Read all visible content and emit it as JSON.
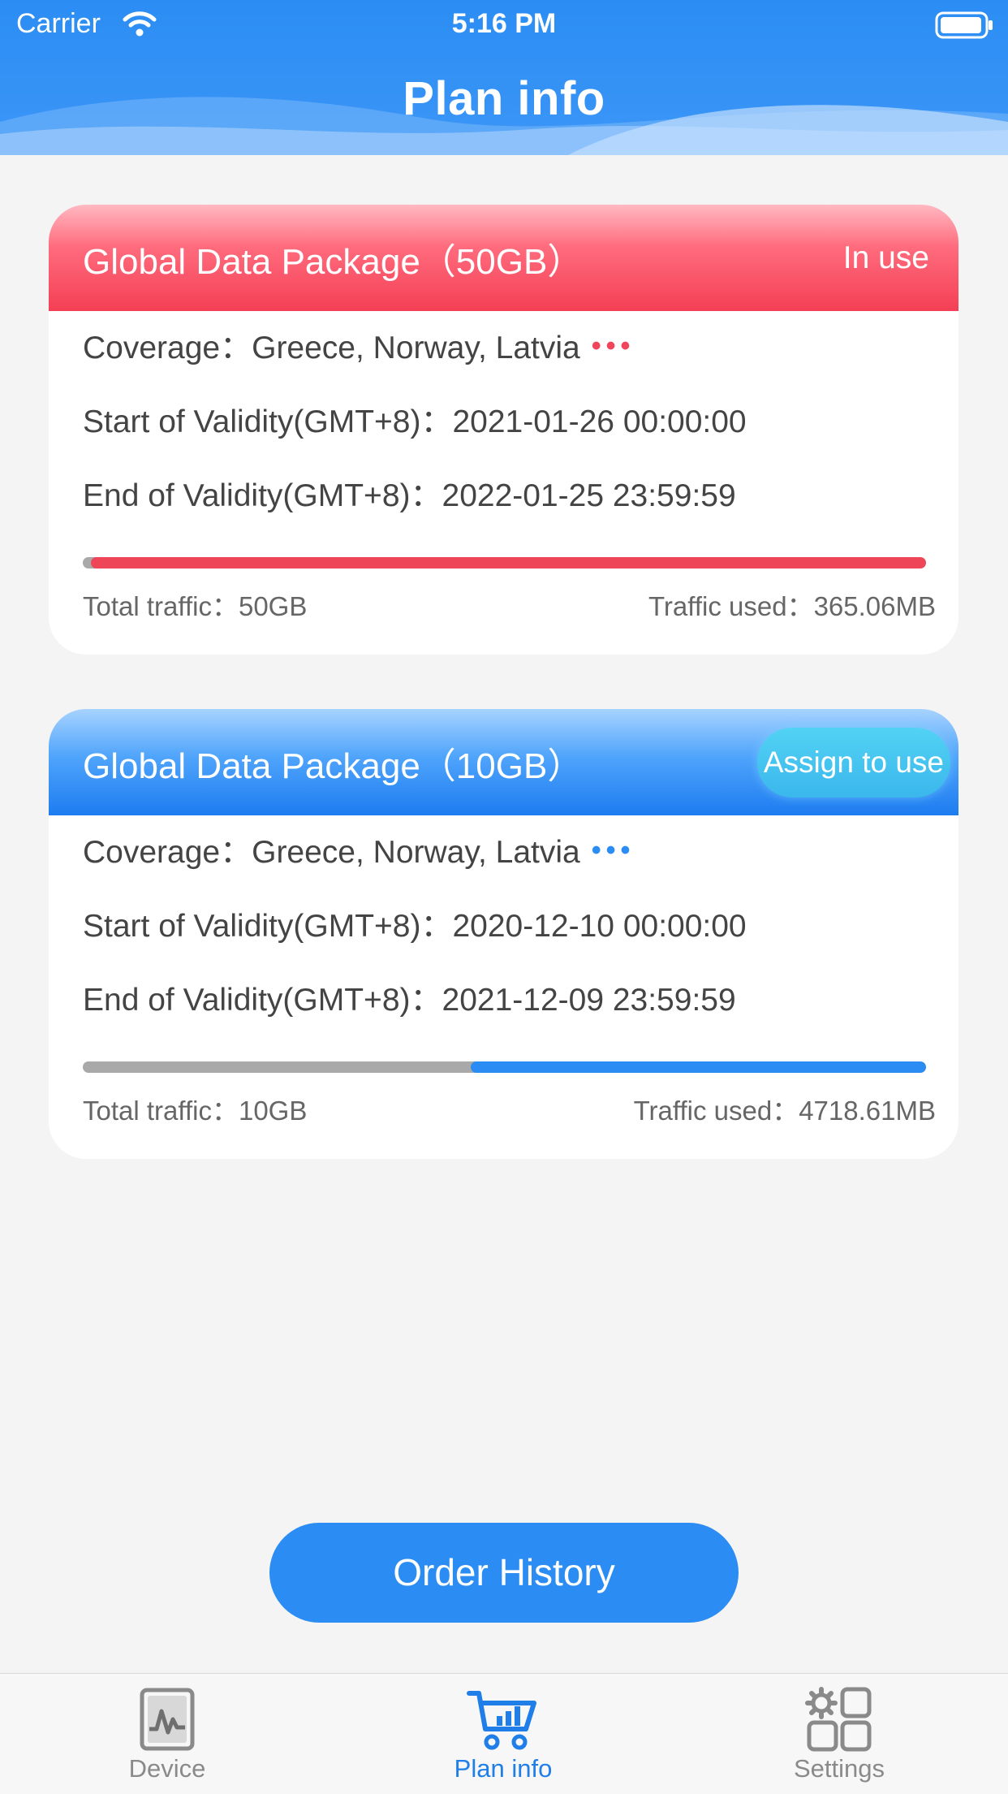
{
  "status_bar": {
    "carrier": "Carrier",
    "time": "5:16 PM"
  },
  "header": {
    "title": "Plan info"
  },
  "plans": [
    {
      "title": "Global Data Package（50GB）",
      "status": "In use",
      "accent": "#f0455b",
      "coverage_label": "Coverage：",
      "coverage_value": "Greece, Norway, Latvia",
      "start_label": "Start of Validity(GMT+8)：",
      "start_value": "2021-01-26 00:00:00",
      "end_label": "End of Validity(GMT+8)：",
      "end_value": "2022-01-25 23:59:59",
      "remaining_fraction": 0.99,
      "total_label": "Total traffic：",
      "total_value": "50GB",
      "used_label": "Traffic used：",
      "used_value": "365.06MB"
    },
    {
      "title": "Global Data Package（10GB）",
      "action": "Assign to use",
      "accent": "#2b8df4",
      "coverage_label": "Coverage：",
      "coverage_value": "Greece, Norway, Latvia",
      "start_label": "Start of Validity(GMT+8)：",
      "start_value": "2020-12-10 00:00:00",
      "end_label": "End of Validity(GMT+8)：",
      "end_value": "2021-12-09 23:59:59",
      "remaining_fraction": 0.54,
      "total_label": "Total traffic：",
      "total_value": "10GB",
      "used_label": "Traffic used：",
      "used_value": "4718.61MB"
    }
  ],
  "order_history": {
    "label": "Order History"
  },
  "tabbar": {
    "items": [
      {
        "label": "Device",
        "icon": "device-icon",
        "active": false
      },
      {
        "label": "Plan info",
        "icon": "cart-icon",
        "active": true
      },
      {
        "label": "Settings",
        "icon": "settings-icon",
        "active": false
      }
    ],
    "active_color": "#1f7ee8",
    "inactive_color": "#8a8a8a"
  }
}
